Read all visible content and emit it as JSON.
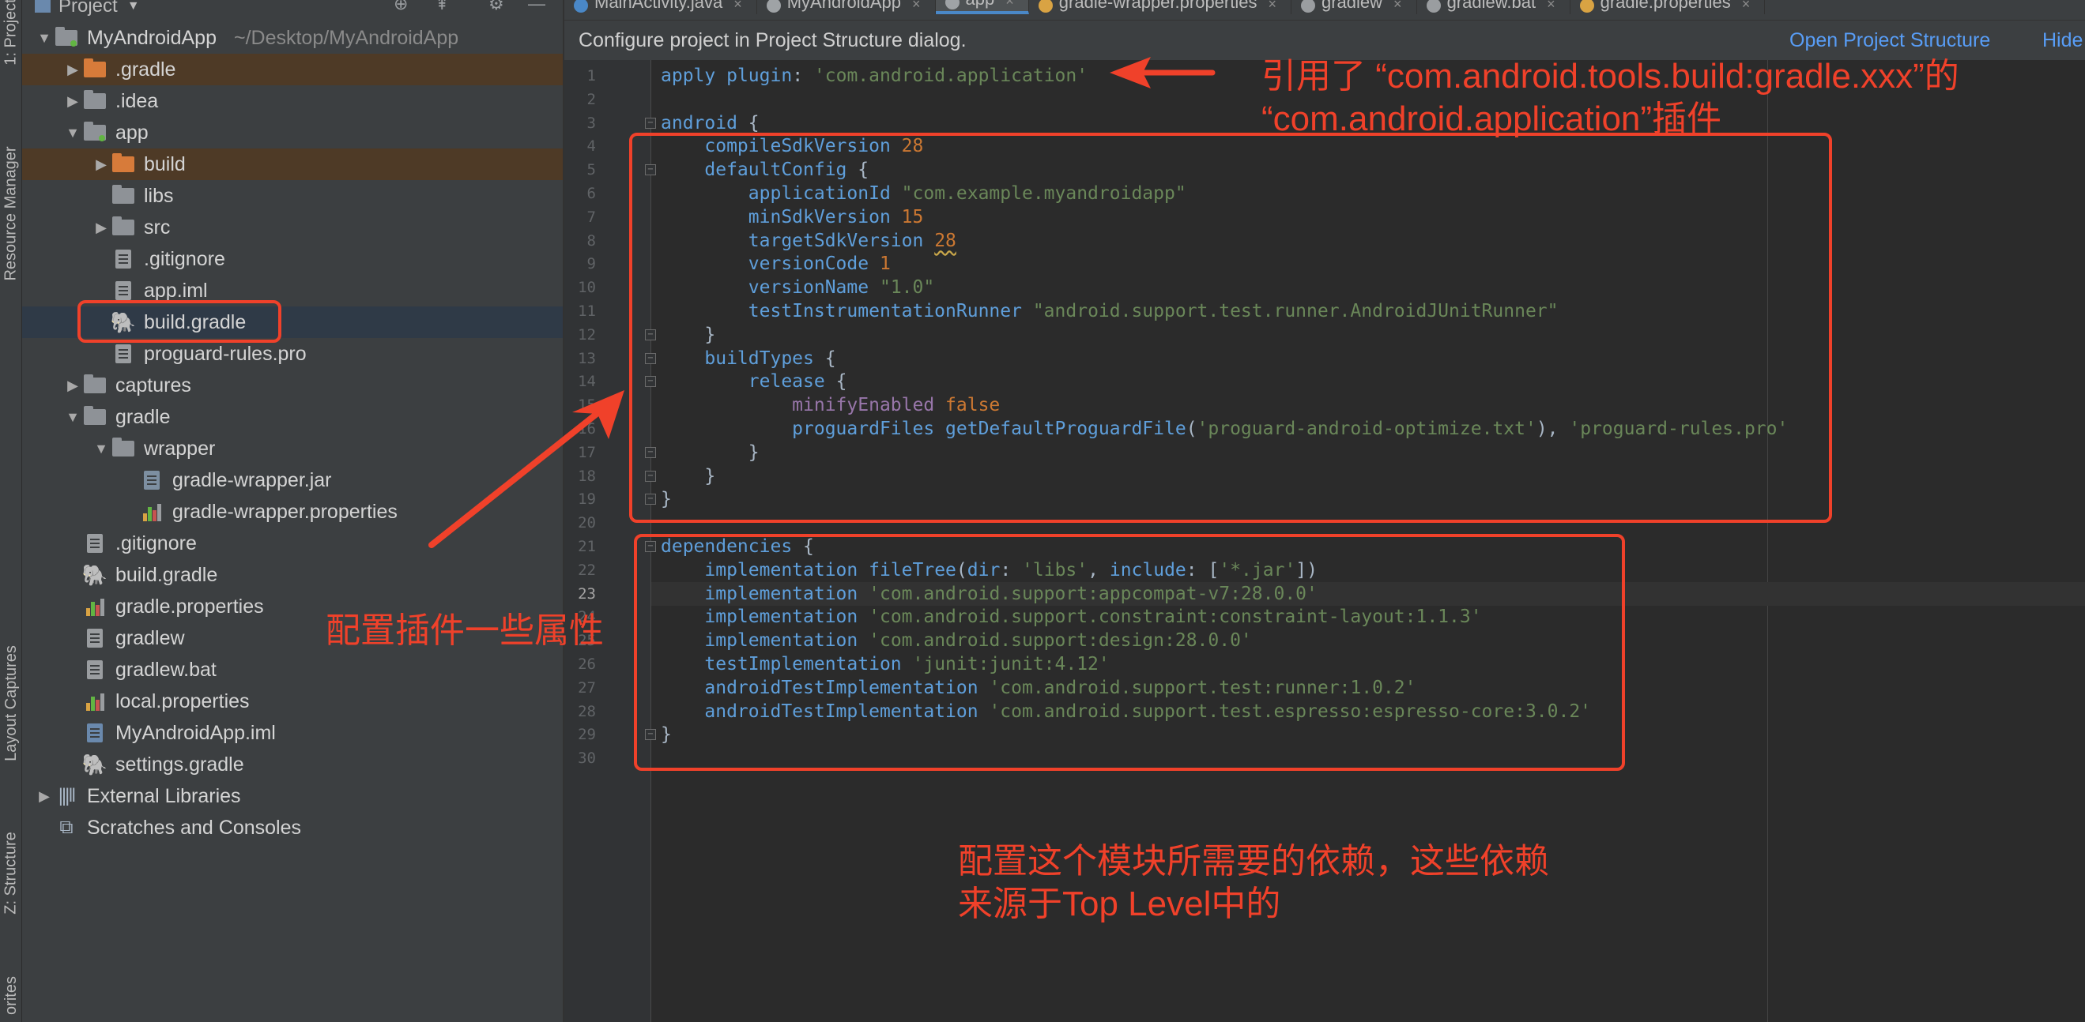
{
  "tool_stripe": {
    "items": [
      "1: Project",
      "Resource Manager",
      "Layout Captures",
      "Z: Structure",
      "orites"
    ]
  },
  "project_panel": {
    "title": "Project",
    "tree": [
      {
        "label": "MyAndroidApp",
        "hint": "~/Desktop/MyAndroidApp",
        "depth": 0,
        "arrow": "down",
        "icon": "module-folder"
      },
      {
        "label": ".gradle",
        "depth": 1,
        "arrow": "right",
        "icon": "folder-orange",
        "state": "excluded"
      },
      {
        "label": ".idea",
        "depth": 1,
        "arrow": "right",
        "icon": "folder"
      },
      {
        "label": "app",
        "depth": 1,
        "arrow": "down",
        "icon": "module-folder"
      },
      {
        "label": "build",
        "depth": 2,
        "arrow": "right",
        "icon": "folder-orange",
        "state": "excluded"
      },
      {
        "label": "libs",
        "depth": 2,
        "arrow": "",
        "icon": "folder"
      },
      {
        "label": "src",
        "depth": 2,
        "arrow": "right",
        "icon": "folder"
      },
      {
        "label": ".gitignore",
        "depth": 2,
        "arrow": "",
        "icon": "file"
      },
      {
        "label": "app.iml",
        "depth": 2,
        "arrow": "",
        "icon": "file"
      },
      {
        "label": "build.gradle",
        "depth": 2,
        "arrow": "",
        "icon": "gradle",
        "state": "selected"
      },
      {
        "label": "proguard-rules.pro",
        "depth": 2,
        "arrow": "",
        "icon": "file"
      },
      {
        "label": "captures",
        "depth": 1,
        "arrow": "right",
        "icon": "folder"
      },
      {
        "label": "gradle",
        "depth": 1,
        "arrow": "down",
        "icon": "folder"
      },
      {
        "label": "wrapper",
        "depth": 2,
        "arrow": "down",
        "icon": "folder"
      },
      {
        "label": "gradle-wrapper.jar",
        "depth": 3,
        "arrow": "",
        "icon": "jar"
      },
      {
        "label": "gradle-wrapper.properties",
        "depth": 3,
        "arrow": "",
        "icon": "properties"
      },
      {
        "label": ".gitignore",
        "depth": 1,
        "arrow": "",
        "icon": "file"
      },
      {
        "label": "build.gradle",
        "depth": 1,
        "arrow": "",
        "icon": "gradle"
      },
      {
        "label": "gradle.properties",
        "depth": 1,
        "arrow": "",
        "icon": "properties"
      },
      {
        "label": "gradlew",
        "depth": 1,
        "arrow": "",
        "icon": "file"
      },
      {
        "label": "gradlew.bat",
        "depth": 1,
        "arrow": "",
        "icon": "file"
      },
      {
        "label": "local.properties",
        "depth": 1,
        "arrow": "",
        "icon": "properties"
      },
      {
        "label": "MyAndroidApp.iml",
        "depth": 1,
        "arrow": "",
        "icon": "module-file"
      },
      {
        "label": "settings.gradle",
        "depth": 1,
        "arrow": "",
        "icon": "gradle"
      },
      {
        "label": "External Libraries",
        "depth": 0,
        "arrow": "right",
        "icon": "libraries"
      },
      {
        "label": "Scratches and Consoles",
        "depth": 0,
        "arrow": "",
        "icon": "scratches"
      }
    ]
  },
  "tabs": [
    {
      "label": "MainActivity.java",
      "icon": "class"
    },
    {
      "label": "MyAndroidApp",
      "icon": "gradle"
    },
    {
      "label": "app",
      "icon": "gradle",
      "active": true
    },
    {
      "label": "gradle-wrapper.properties",
      "icon": "properties"
    },
    {
      "label": "gradlew",
      "icon": "file"
    },
    {
      "label": "gradlew.bat",
      "icon": "file"
    },
    {
      "label": "gradle.properties",
      "icon": "properties"
    }
  ],
  "banner": {
    "message": "Configure project in Project Structure dialog.",
    "link": "Open Project Structure",
    "link2": "Hide"
  },
  "editor": {
    "current_line": 23,
    "lines": [
      "apply plugin: 'com.android.application'",
      "",
      "android {",
      "    compileSdkVersion 28",
      "    defaultConfig {",
      "        applicationId \"com.example.myandroidapp\"",
      "        minSdkVersion 15",
      "        targetSdkVersion 28",
      "        versionCode 1",
      "        versionName \"1.0\"",
      "        testInstrumentationRunner \"android.support.test.runner.AndroidJUnitRunner\"",
      "    }",
      "    buildTypes {",
      "        release {",
      "            minifyEnabled false",
      "            proguardFiles getDefaultProguardFile('proguard-android-optimize.txt'), 'proguard-rules.pro'",
      "        }",
      "    }",
      "}",
      "",
      "dependencies {",
      "    implementation fileTree(dir: 'libs', include: ['*.jar'])",
      "    implementation 'com.android.support:appcompat-v7:28.0.0'",
      "    implementation 'com.android.support.constraint:constraint-layout:1.1.3'",
      "    implementation 'com.android.support:design:28.0.0'",
      "    testImplementation 'junit:junit:4.12'",
      "    androidTestImplementation 'com.android.support.test:runner:1.0.2'",
      "    androidTestImplementation 'com.android.support.test.espresso:espresso-core:3.0.2'",
      "}",
      ""
    ]
  },
  "annotations": {
    "plugin_note_line1": "引用了 “com.android.tools.build:gradle.xxx”的",
    "plugin_note_line2": "“com.android.application”插件",
    "config_note": "配置插件一些属性",
    "deps_note_line1": "配置这个模块所需要的依赖，这些依赖",
    "deps_note_line2": "来源于Top Level中的",
    "color": "#f0412a"
  }
}
